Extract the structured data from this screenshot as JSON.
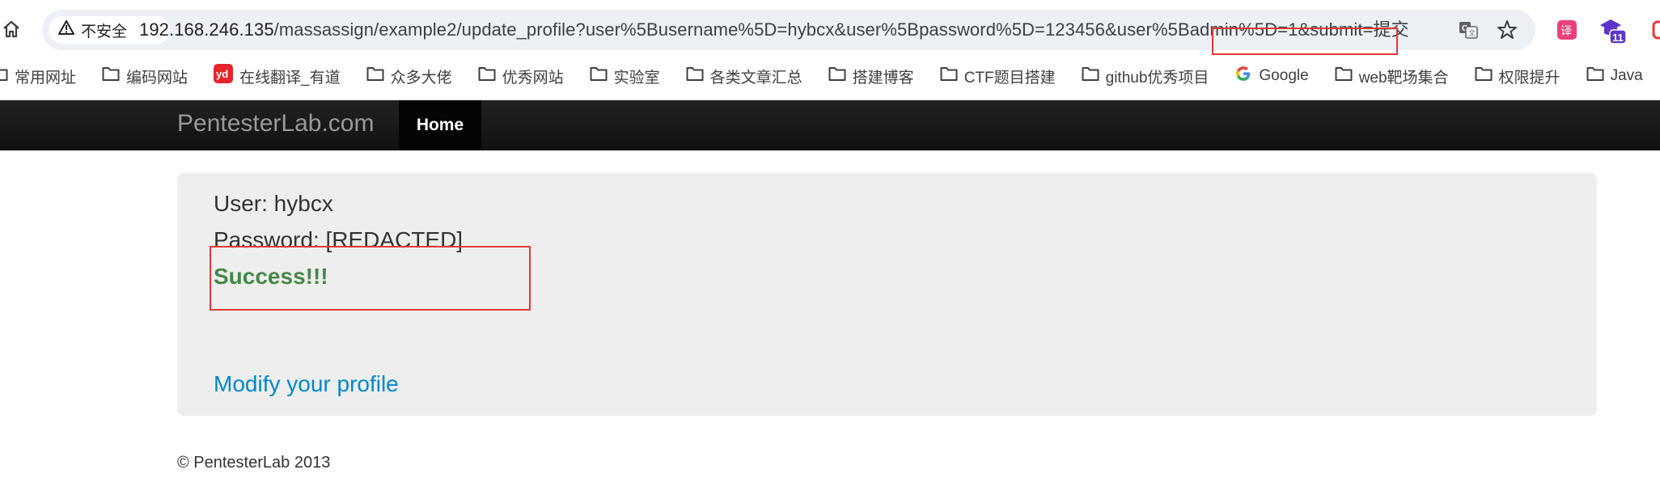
{
  "browser": {
    "security_label": "不安全",
    "url_host": "192.168.246.135",
    "url_path": "/massassign/example2/update_profile?user%5Busername%5D=hybcx&user%5Bpassword%5D=123456&user%5Badmin%5D=1&submit=提交",
    "extension_badge": "11",
    "icons": [
      "home-icon",
      "warning-icon",
      "translate-icon",
      "star-icon"
    ]
  },
  "bookmarks": [
    {
      "label": "常用网址",
      "icon": "folder-icon"
    },
    {
      "label": "编码网站",
      "icon": "folder-icon"
    },
    {
      "label": "在线翻译_有道",
      "icon": "youdao-icon"
    },
    {
      "label": "众多大佬",
      "icon": "folder-icon"
    },
    {
      "label": "优秀网站",
      "icon": "folder-icon"
    },
    {
      "label": "实验室",
      "icon": "folder-icon"
    },
    {
      "label": "各类文章汇总",
      "icon": "folder-icon"
    },
    {
      "label": "搭建博客",
      "icon": "folder-icon"
    },
    {
      "label": "CTF题目搭建",
      "icon": "folder-icon"
    },
    {
      "label": "github优秀项目",
      "icon": "folder-icon"
    },
    {
      "label": "Google",
      "icon": "google-icon"
    },
    {
      "label": "web靶场集合",
      "icon": "folder-icon"
    },
    {
      "label": "权限提升",
      "icon": "folder-icon"
    },
    {
      "label": "Java",
      "icon": "folder-icon"
    }
  ],
  "navbar": {
    "brand": "PentesterLab.com",
    "home": "Home"
  },
  "profile": {
    "user_line": "User: hybcx",
    "password_line": "Password: [REDACTED]",
    "success": "Success!!!",
    "modify_link": "Modify your profile"
  },
  "footer": {
    "copyright": "© PentesterLab 2013"
  },
  "colors": {
    "annotation": "#e53935",
    "success": "#468847",
    "link": "#0088cc"
  }
}
